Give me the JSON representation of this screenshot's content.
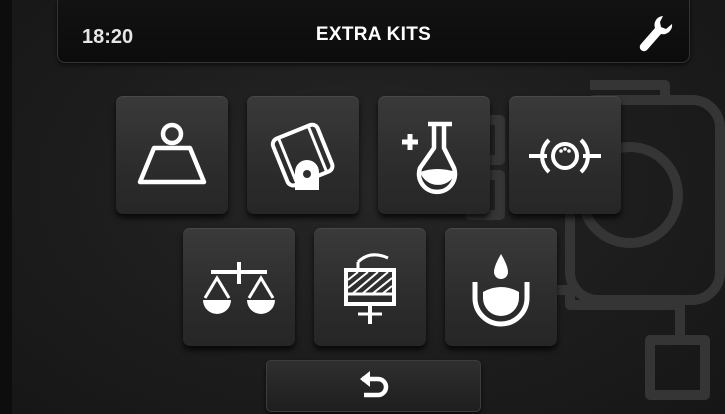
{
  "header": {
    "time": "18:20",
    "title": "EXTRA KITS",
    "settings_icon": "wrench-icon"
  },
  "kits": [
    {
      "icon": "weight-icon"
    },
    {
      "icon": "filter-cartridge-icon"
    },
    {
      "icon": "add-reagent-flask-icon"
    },
    {
      "icon": "sensor-icon"
    },
    {
      "icon": "balance-scale-icon"
    },
    {
      "icon": "filter-housing-icon"
    },
    {
      "icon": "water-drop-bowl-icon"
    }
  ],
  "footer": {
    "back_icon": "back-arrow-icon"
  },
  "colors": {
    "background": "#1b1b1b",
    "tile": "#333333",
    "icon": "#ffffff",
    "watermark": "#3a3a3a"
  }
}
